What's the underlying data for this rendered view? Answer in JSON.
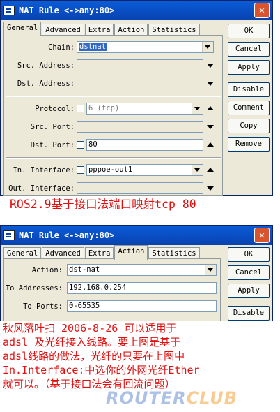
{
  "window1": {
    "title": "NAT Rule <->any:80>",
    "tabs": [
      "General",
      "Advanced",
      "Extra",
      "Action",
      "Statistics"
    ],
    "fields": {
      "chain": {
        "label": "Chain:",
        "value": "dstnat"
      },
      "src_address": {
        "label": "Src. Address:"
      },
      "dst_address": {
        "label": "Dst. Address:"
      },
      "protocol": {
        "label": "Protocol:",
        "value": "6 (tcp)"
      },
      "src_port": {
        "label": "Src. Port:"
      },
      "dst_port": {
        "label": "Dst. Port:",
        "value": "80"
      },
      "in_interface": {
        "label": "In. Interface:",
        "value": "pppoe-out1"
      },
      "out_interface": {
        "label": "Out. Interface:"
      }
    },
    "buttons": [
      "OK",
      "Cancel",
      "Apply",
      "Disable",
      "Comment",
      "Copy",
      "Remove"
    ]
  },
  "caption1": "ROS2.9基于接口法端口映射tcp 80",
  "window2": {
    "title": "NAT Rule <->any:80>",
    "tabs": [
      "General",
      "Advanced",
      "Extra",
      "Action",
      "Statistics"
    ],
    "fields": {
      "action": {
        "label": "Action:",
        "value": "dst-nat"
      },
      "to_addresses": {
        "label": "To Addresses:",
        "value": "192.168.0.254"
      },
      "to_ports": {
        "label": "To Ports:",
        "value": "0-65535"
      }
    },
    "buttons": [
      "OK",
      "Cancel",
      "Apply",
      "Disable"
    ]
  },
  "caption2": {
    "line1": "秋风落叶扫 2006-8-26 可以适用于",
    "line2": "adsl 及光纤接入线路。要上图是基于",
    "line3": "adsl线路的做法，光纤的只要在上图中",
    "line4": "In.Interface:中选你的外网光纤Ether",
    "line5": "就可以。（基于接口法会有回流问题）"
  },
  "watermark": {
    "part1": "ROUTER",
    "part2": "CLUB"
  }
}
